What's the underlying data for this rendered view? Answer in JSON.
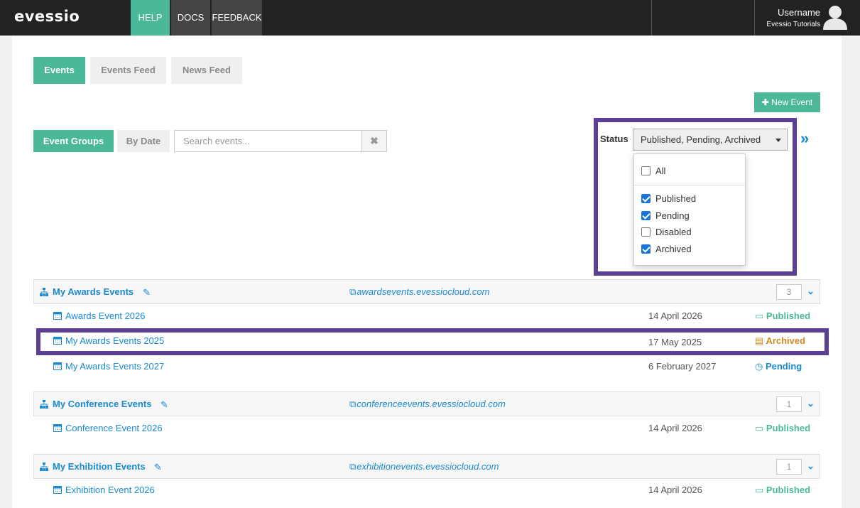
{
  "app": {
    "logo": "evessio"
  },
  "topnav": [
    {
      "label": "HELP"
    },
    {
      "label": "DOCS"
    },
    {
      "label": "FEEDBACK"
    }
  ],
  "user": {
    "name": "Username",
    "subtitle": "Evessio Tutorials",
    "avatar_icon": "user-avatar-icon"
  },
  "tabs": [
    {
      "label": "Events",
      "active": true
    },
    {
      "label": "Events Feed"
    },
    {
      "label": "News Feed"
    }
  ],
  "toolbar": {
    "new_event_label": "New Event",
    "new_event_icon": "plus-icon"
  },
  "view_toggle": [
    {
      "label": "Event Groups",
      "active": true
    },
    {
      "label": "By Date"
    }
  ],
  "search": {
    "placeholder": "Search events...",
    "value": "",
    "clear_icon": "close-icon"
  },
  "status_filter": {
    "label": "Status",
    "selected": "Published, Pending, Archived",
    "options": [
      {
        "label": "All",
        "checked": false
      },
      {
        "label": "Published",
        "checked": true
      },
      {
        "label": "Pending",
        "checked": true
      },
      {
        "label": "Disabled",
        "checked": false
      },
      {
        "label": "Archived",
        "checked": true
      }
    ],
    "collapse_icon": "double-chevron-right-icon"
  },
  "highlight_color": "#5b3f94",
  "accent_color": "#4cb89a",
  "groups": [
    {
      "title": "My Awards Events",
      "url": "awardsevents.evessiocloud.com",
      "count": "3",
      "events": [
        {
          "name": "Awards Event 2026",
          "date": "14 April 2026",
          "status": "Published"
        },
        {
          "name": "My Awards Events 2025",
          "date": "17 May 2025",
          "status": "Archived"
        },
        {
          "name": "My Awards Events 2027",
          "date": "6 February 2027",
          "status": "Pending"
        }
      ]
    },
    {
      "title": "My Conference Events",
      "url": "conferenceevents.evessiocloud.com",
      "count": "1",
      "events": [
        {
          "name": "Conference Event 2026",
          "date": "14 April 2026",
          "status": "Published"
        }
      ]
    },
    {
      "title": "My Exhibition Events",
      "url": "exhibitionevents.evessiocloud.com",
      "count": "1",
      "events": [
        {
          "name": "Exhibition Event 2026",
          "date": "14 April 2026",
          "status": "Published"
        }
      ]
    }
  ]
}
